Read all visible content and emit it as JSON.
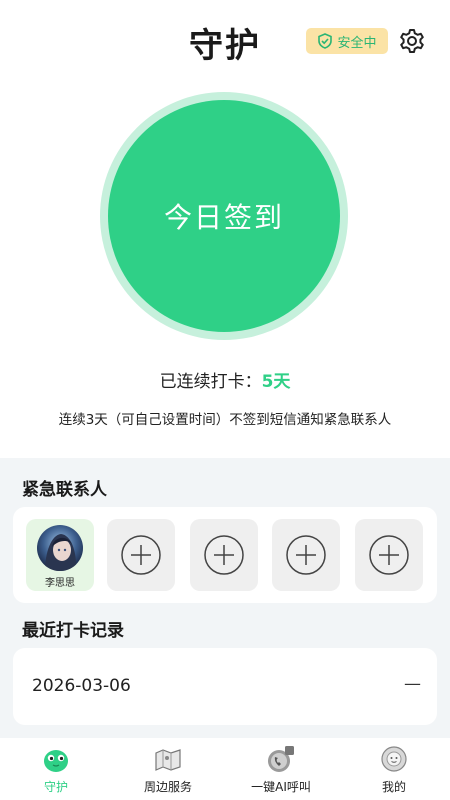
{
  "header": {
    "title": "守护",
    "safe_badge": "安全中",
    "settings_icon": "gear-icon"
  },
  "checkin": {
    "button_label": "今日签到",
    "streak_label": "已连续打卡：",
    "streak_value": "5天",
    "notice": "连续3天（可自己设置时间）不签到短信通知紧急联系人"
  },
  "contacts": {
    "title": "紧急联系人",
    "items": [
      {
        "name": "李思思",
        "icon": "avatar"
      },
      {
        "icon": "plus-circle-icon"
      },
      {
        "icon": "plus-circle-icon"
      },
      {
        "icon": "plus-circle-icon"
      },
      {
        "icon": "plus-circle-icon"
      }
    ]
  },
  "records": {
    "title": "最近打卡记录",
    "items": [
      {
        "date": "2026-03-06",
        "status": "—"
      }
    ]
  },
  "tabbar": {
    "items": [
      {
        "label": "守护",
        "icon": "green-mascot-icon",
        "active": true
      },
      {
        "label": "周边服务",
        "icon": "map-icon",
        "active": false
      },
      {
        "label": "一键AI呼叫",
        "icon": "phone-call-icon",
        "active": false
      },
      {
        "label": "我的",
        "icon": "profile-icon",
        "active": false
      }
    ]
  },
  "colors": {
    "accent_green": "#2fd087",
    "ring_green": "#c6f0dc",
    "badge_bg": "#fbe3a6",
    "page_gray": "#f2f5f7"
  }
}
